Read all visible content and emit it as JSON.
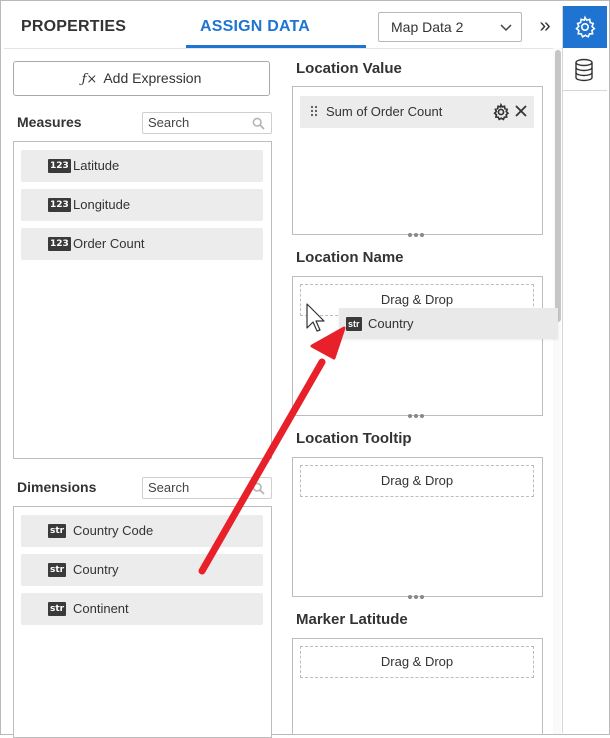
{
  "header": {
    "tab_properties": "PROPERTIES",
    "tab_assign_data": "ASSIGN DATA",
    "map_select_value": "Map Data 2",
    "expand_glyph": "»"
  },
  "toolbar": {
    "add_expression_icon": "ƒ×",
    "add_expression_label": "Add Expression"
  },
  "measures": {
    "label": "Measures",
    "search_placeholder": "Search",
    "items": [
      {
        "badge": "123",
        "label": "Latitude"
      },
      {
        "badge": "123",
        "label": "Longitude"
      },
      {
        "badge": "123",
        "label": "Order Count"
      }
    ]
  },
  "dimensions": {
    "label": "Dimensions",
    "search_placeholder": "Search",
    "items": [
      {
        "badge": "str",
        "label": "Country Code"
      },
      {
        "badge": "str",
        "label": "Country"
      },
      {
        "badge": "str",
        "label": "Continent"
      }
    ]
  },
  "drop_zones": {
    "location_value": {
      "title": "Location Value",
      "assigned": "Sum of Order Count"
    },
    "location_name": {
      "title": "Location Name",
      "placeholder": "Drag & Drop"
    },
    "location_tooltip": {
      "title": "Location Tooltip",
      "placeholder": "Drag & Drop"
    },
    "marker_latitude": {
      "title": "Marker Latitude",
      "placeholder": "Drag & Drop"
    }
  },
  "drag_ghost": {
    "badge": "str",
    "label": "Country"
  },
  "colors": {
    "accent": "#1f74d1",
    "annotation_arrow": "#e8202a"
  },
  "icons": {
    "side_active": "gear-icon",
    "side_secondary": "database-icon"
  }
}
